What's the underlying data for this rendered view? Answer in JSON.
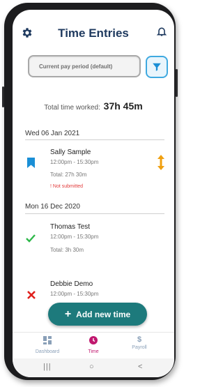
{
  "header": {
    "title": "Time Entries",
    "settings_icon": "gear-icon",
    "notifications_icon": "bell-icon"
  },
  "filter": {
    "period_value": "Current pay period (default)",
    "filter_icon": "filter-icon"
  },
  "summary": {
    "label": "Total time worked:",
    "value": "37h 45m"
  },
  "groups": [
    {
      "date": "Wed 06 Jan 2021",
      "entries": [
        {
          "name": "Sally Sample",
          "time": "12:00pm - 15:30pm",
          "total": "Total: 27h 30m",
          "warning": "! Not submitted",
          "status_icon": "bookmark-icon",
          "action_icon": "reorder-icon"
        }
      ]
    },
    {
      "date": "Mon 16 Dec 2020",
      "entries": [
        {
          "name": "Thomas Test",
          "time": "12:00pm - 15:30pm",
          "total": "Total: 3h 30m",
          "status_icon": "check-icon"
        },
        {
          "name": "Debbie Demo",
          "time": "12:00pm - 15:30pm",
          "status_icon": "cross-icon"
        }
      ]
    }
  ],
  "add_button": {
    "label": "Add new time"
  },
  "nav": [
    {
      "label": "Dashboard",
      "icon": "dashboard-icon",
      "active": false
    },
    {
      "label": "Time",
      "icon": "clock-icon",
      "active": true
    },
    {
      "label": "Payroll",
      "icon": "dollar-icon",
      "active": false
    }
  ],
  "system_nav": {
    "recent": "|||",
    "home": "○",
    "back": "<"
  },
  "colors": {
    "title": "#1f3a5f",
    "accent": "#3fa9e0",
    "button": "#1d7a7c",
    "active_nav": "#c0186f",
    "warning": "#e23b3b",
    "success": "#2eb84a",
    "cross": "#e0201c",
    "bookmark": "#1a8fd6",
    "reorder": "#f0a010"
  }
}
